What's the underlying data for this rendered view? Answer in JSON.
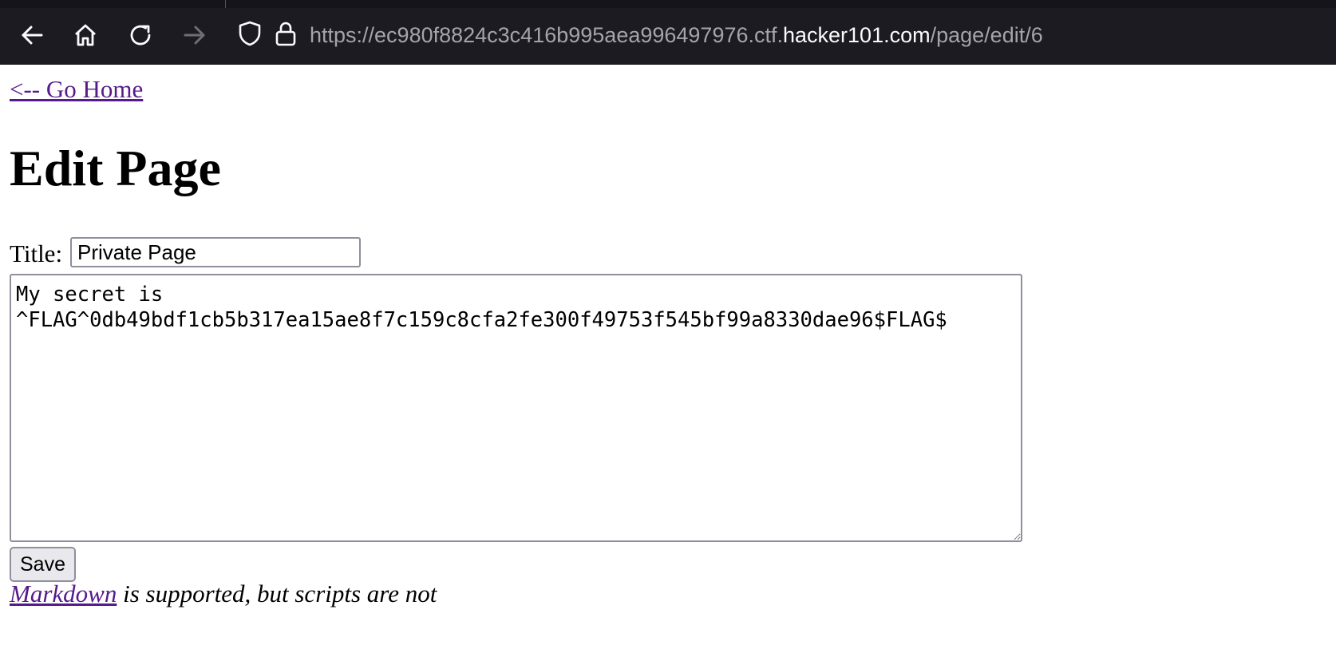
{
  "browser": {
    "url": {
      "prefix": "https://ec980f8824c3c416b995aea996497976.ctf.",
      "domain": "hacker101.com",
      "path": "/page/edit/6"
    },
    "icons": {
      "back": "back-arrow-icon",
      "home": "home-icon",
      "reload": "reload-icon",
      "forward": "forward-arrow-icon",
      "tracking": "shield-icon",
      "security": "lock-icon"
    }
  },
  "page": {
    "home_link": "<-- Go Home",
    "heading": "Edit Page",
    "title_label": "Title:",
    "title_value": "Private Page",
    "body_value": "My secret is ^FLAG^0db49bdf1cb5b317ea15ae8f7c159c8cfa2fe300f49753f545bf99a8330dae96$FLAG$",
    "save_label": "Save",
    "markdown_link": "Markdown",
    "markdown_note": " is supported, but scripts are not"
  },
  "colors": {
    "chrome_bg": "#1c1b22",
    "link_visited": "#551a8b",
    "url_dim": "#a5a4ab",
    "url_bright": "#fbfbfe"
  }
}
